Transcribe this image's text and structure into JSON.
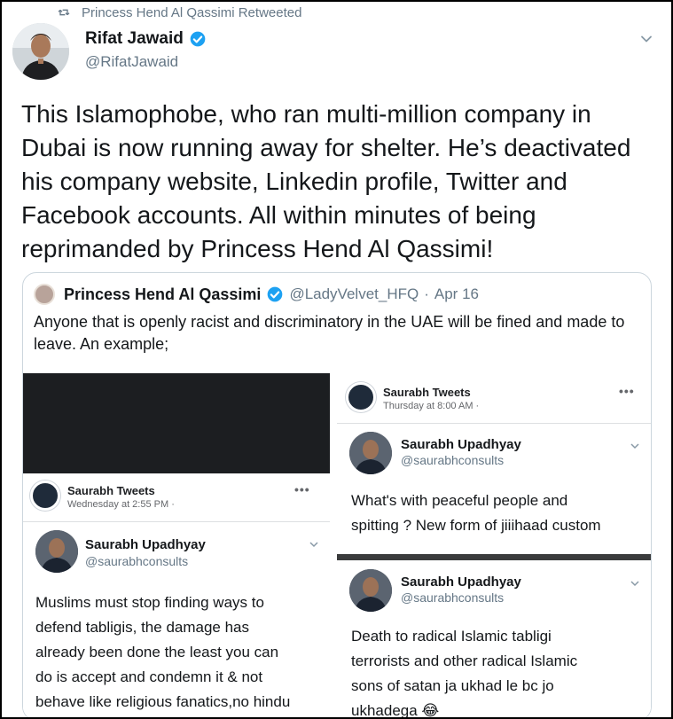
{
  "retweet": {
    "label": "Princess Hend Al Qassimi Retweeted"
  },
  "author": {
    "name": "Rifat Jawaid",
    "handle": "@RifatJawaid"
  },
  "tweet": {
    "text": "This Islamophobe, who ran multi-million company in\nDubai is now running away for shelter. He’s deactivated\nhis company website, Linkedin profile, Twitter and\nFacebook accounts. All within minutes of being\nreprimanded by Princess Hend Al Qassimi!"
  },
  "quote": {
    "name": "Princess Hend Al Qassimi",
    "handle": "@LadyVelvet_HFQ",
    "separator": "·",
    "date": "Apr 16",
    "text": "Anyone that is openly racist and discriminatory in the UAE will be fined and made to leave. An example;"
  },
  "screenshots": {
    "left": {
      "page_name": "Saurabh Tweets",
      "meta": "Wednesday at 2:55 PM ·",
      "dots": "•••",
      "user_name": "Saurabh Upadhyay",
      "user_handle": "@saurabhconsults",
      "body": "Muslims must stop finding ways to\ndefend tabligis, the damage has\nalready been done the least you can\ndo is accept and condemn it & not\nbehave like religious fanatics,no hindu"
    },
    "right_top": {
      "page_name": "Saurabh Tweets",
      "meta": "Thursday at 8:00 AM ·",
      "dots": "•••",
      "user_name": "Saurabh Upadhyay",
      "user_handle": "@saurabhconsults",
      "body": "What's with peaceful people and\nspitting ? New form of jiiihaad custom"
    },
    "right_bottom": {
      "user_name": "Saurabh Upadhyay",
      "user_handle": "@saurabhconsults",
      "body": "Death to radical Islamic tabligi\nterrorists and other radical Islamic\nsons of satan ja ukhad le bc jo\nukhadega 😂"
    }
  },
  "colors": {
    "verified": "#1da1f2",
    "secondary_text": "#657786",
    "border": "#ccd6dd"
  }
}
